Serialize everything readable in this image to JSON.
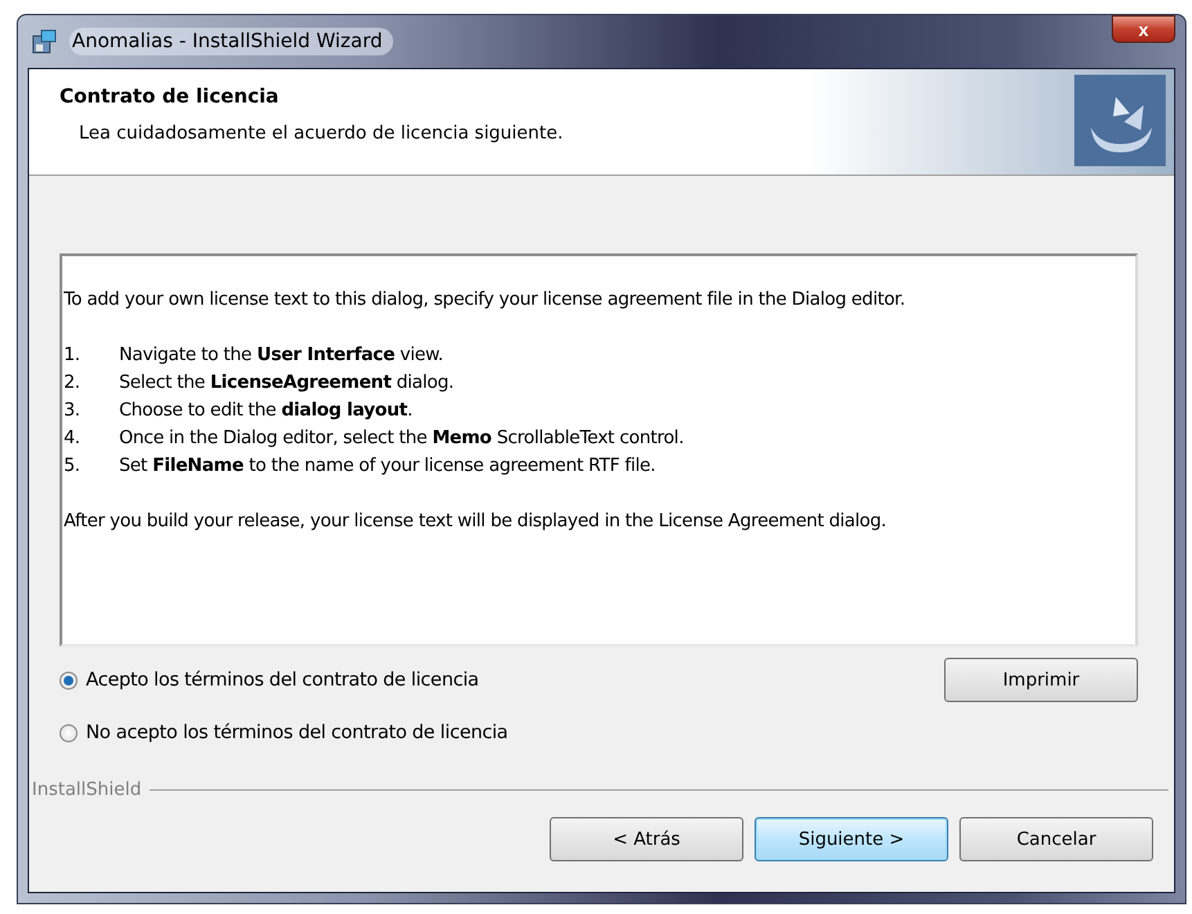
{
  "window": {
    "title": "Anomalias - InstallShield Wizard",
    "close": "x"
  },
  "header": {
    "title": "Contrato de licencia",
    "subtitle": "Lea cuidadosamente el acuerdo de licencia siguiente."
  },
  "license": {
    "intro": "To add your own license text to this dialog, specify your license agreement file in the Dialog editor.",
    "steps": [
      {
        "number": "1.",
        "text": "Navigate to the **User Interface** view."
      },
      {
        "number": "2.",
        "text": "Select the **LicenseAgreement** dialog."
      },
      {
        "number": "3.",
        "text": "Choose to edit the **dialog layout**."
      },
      {
        "number": "4.",
        "text": "Once in the Dialog editor, select the **Memo** ScrollableText control."
      },
      {
        "number": "5.",
        "text": "Set **FileName** to the name of your license agreement RTF file."
      }
    ],
    "outro": "After you build your release, your license text will be displayed in the License Agreement dialog."
  },
  "print_button": {
    "label": "Imprimir"
  },
  "options": [
    {
      "label": "Acepto los términos del contrato de licencia",
      "selected": true
    },
    {
      "label": "No acepto los términos del contrato de licencia",
      "selected": false
    }
  ],
  "brand": "InstallShield",
  "buttons": [
    {
      "label": "< Atrás",
      "default": false
    },
    {
      "label": "Siguiente >",
      "default": true
    },
    {
      "label": "Cancelar",
      "default": false
    }
  ]
}
